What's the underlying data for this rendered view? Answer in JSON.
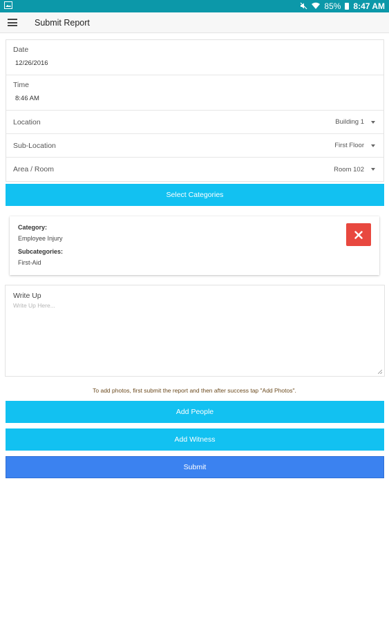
{
  "status_bar": {
    "battery": "85%",
    "time": "8:47 AM"
  },
  "app_bar": {
    "title": "Submit Report"
  },
  "form": {
    "date": {
      "label": "Date",
      "value": "12/26/2016"
    },
    "time": {
      "label": "Time",
      "value": "8:46 AM"
    },
    "location": {
      "label": "Location",
      "value": "Building 1"
    },
    "sub_location": {
      "label": "Sub-Location",
      "value": "First Floor"
    },
    "area_room": {
      "label": "Area / Room",
      "value": "Room 102"
    }
  },
  "buttons": {
    "select_categories": "Select Categories",
    "add_people": "Add People",
    "add_witness": "Add Witness",
    "submit": "Submit"
  },
  "category_card": {
    "category_label": "Category:",
    "category_value": "Employee Injury",
    "subcategories_label": "Subcategories:",
    "subcategories_value": "First-Aid"
  },
  "writeup": {
    "label": "Write Up",
    "placeholder": "Write Up Here..."
  },
  "notice": "To add photos, first submit the report and then after success tap \"Add Photos\".",
  "colors": {
    "status_bar": "#0c98a9",
    "accent_button": "#12c1f1",
    "submit_button": "#3b82f0",
    "delete_button": "#e8483f"
  }
}
